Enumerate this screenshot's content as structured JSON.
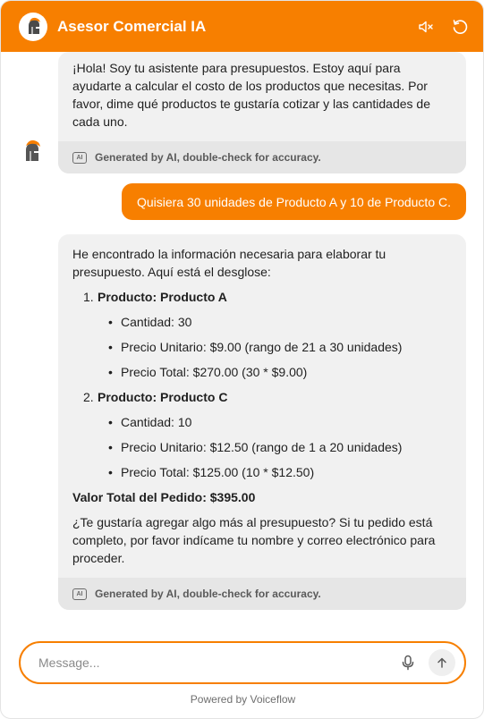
{
  "header": {
    "title": "Asesor Comercial IA",
    "mute_icon": "speaker-muted-icon",
    "reset_icon": "restart-icon",
    "accent": "#f77f00"
  },
  "messages": {
    "bot1": {
      "text": "¡Hola! Soy tu asistente para presupuestos. Estoy aquí para ayudarte a calcular el costo de los productos que necesitas. Por favor, dime qué productos te gustaría cotizar y las cantidades de cada uno.",
      "footer": "Generated by AI, double-check for accuracy.",
      "badge": "AI"
    },
    "user1": {
      "text": "Quisiera 30 unidades de Producto A y 10 de Producto C."
    },
    "bot2": {
      "intro": "He encontrado la información necesaria para elaborar tu presupuesto. Aquí está el desglose:",
      "items": [
        {
          "num": "1.",
          "title": "Producto: Producto A",
          "details": [
            "Cantidad: 30",
            "Precio Unitario: $9.00 (rango de 21 a 30 unidades)",
            "Precio Total: $270.00 (30 * $9.00)"
          ]
        },
        {
          "num": "2.",
          "title": "Producto: Producto C",
          "details": [
            "Cantidad: 10",
            "Precio Unitario: $12.50 (rango de 1 a 20 unidades)",
            "Precio Total: $125.00 (10 * $12.50)"
          ]
        }
      ],
      "total": "Valor Total del Pedido: $395.00",
      "outro": "¿Te gustaría agregar algo más al presupuesto? Si tu pedido está completo, por favor indícame tu nombre y correo electrónico para proceder.",
      "footer": "Generated by AI, double-check for accuracy.",
      "badge": "AI"
    }
  },
  "composer": {
    "placeholder": "Message...",
    "mic_icon": "microphone-icon",
    "send_icon": "arrow-up-icon"
  },
  "footer": {
    "powered_by": "Powered by Voiceflow"
  }
}
